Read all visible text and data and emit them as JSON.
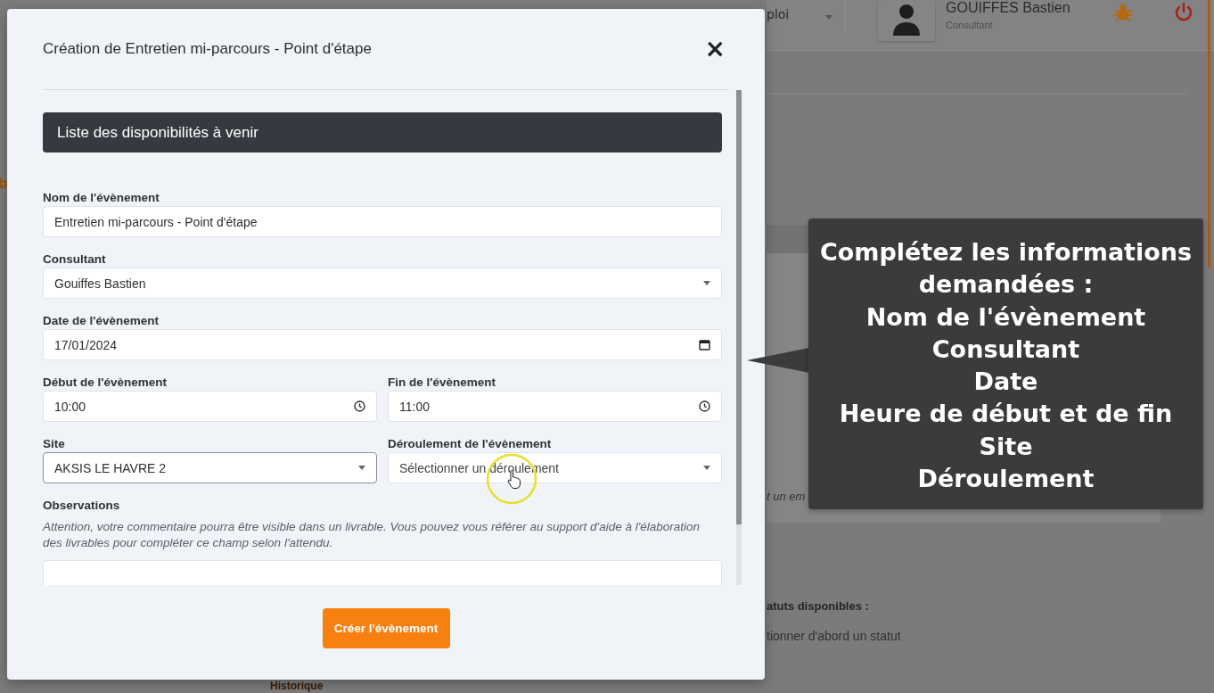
{
  "background": {
    "select_value": "ploi",
    "user_name": "GOUIFFES Bastien",
    "user_role": "Consultant",
    "side_letter": "b",
    "italic_text": "t un em",
    "status_label": "atuts disponibles :",
    "status_hint": "tionner d'abord un statut",
    "history_title": "Historique"
  },
  "modal": {
    "title": "Création de Entretien mi-parcours - Point d'étape",
    "close": "×",
    "section": "Liste des disponibilités à venir",
    "rows": [
      [
        {
          "kind": "text",
          "label": "Nom de l'évènement",
          "value": "Entretien mi-parcours - Point d'étape",
          "focused": false
        }
      ],
      [
        {
          "kind": "select",
          "label": "Consultant",
          "value": "Gouiffes Bastien",
          "focused": false
        }
      ],
      [
        {
          "kind": "date",
          "label": "Date de l'évènement",
          "value": "17/01/2024",
          "focused": false
        }
      ],
      [
        {
          "kind": "time",
          "label": "Début de l'évènement",
          "value": "10:00",
          "focused": false
        },
        {
          "kind": "time",
          "label": "Fin de l'évènement",
          "value": "11:00",
          "focused": false
        }
      ],
      [
        {
          "kind": "select",
          "label": "Site",
          "value": "AKSIS LE HAVRE 2",
          "focused": true
        },
        {
          "kind": "select",
          "label": "Déroulement de l'évènement",
          "placeholder": "Sélectionner un déroulement",
          "focused": false
        }
      ],
      [
        {
          "kind": "textarea",
          "label": "Observations",
          "help": "Attention, votre commentaire pourra être visible dans un livrable. Vous pouvez vous référer au support d'aide à l'élaboration des livrables pour compléter ce champ selon l'attendu.",
          "focused": false
        }
      ]
    ],
    "submit": "Créer l'évènement"
  },
  "callout": {
    "lines": [
      "Complétez les informations demandées :",
      "Nom de l'évènement",
      "Consultant",
      "Date",
      "Heure de début et de fin",
      "Site",
      "Déroulement"
    ]
  }
}
